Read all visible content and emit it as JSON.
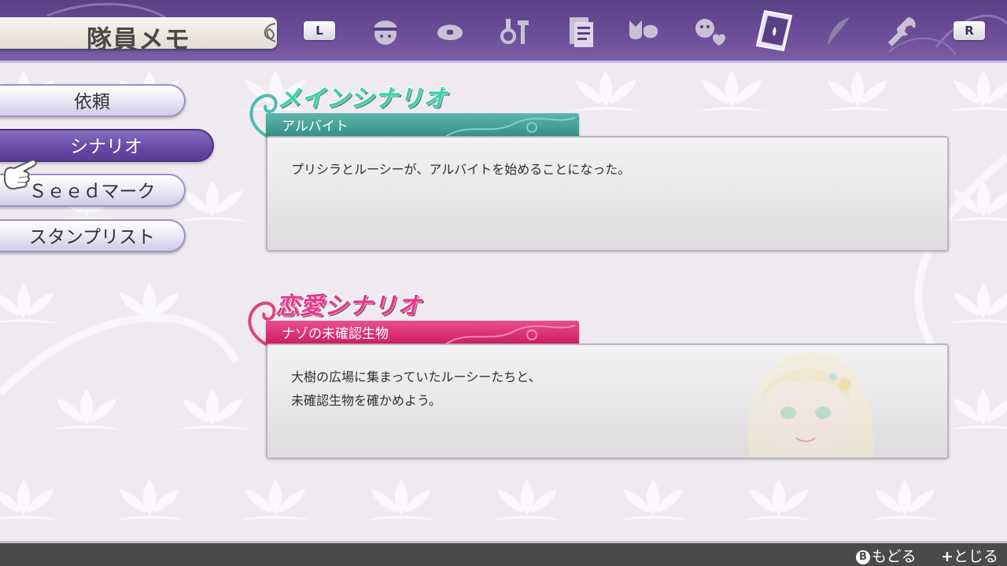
{
  "header": {
    "title": "隊員メモ",
    "left_button": "L",
    "right_button": "R",
    "tabs": [
      {
        "icon": "character-icon"
      },
      {
        "icon": "pouch-icon"
      },
      {
        "icon": "tools-icon"
      },
      {
        "icon": "document-icon"
      },
      {
        "icon": "monsters-icon"
      },
      {
        "icon": "affection-icon"
      },
      {
        "icon": "memo-card-icon",
        "active": true
      },
      {
        "icon": "quill-icon"
      },
      {
        "icon": "wrench-icon"
      }
    ]
  },
  "menu": {
    "items": [
      {
        "label": "依頼"
      },
      {
        "label": "シナリオ",
        "active": true
      },
      {
        "label": "Ｓｅｅｄマーク"
      },
      {
        "label": "スタンプリスト"
      }
    ]
  },
  "main_scenario": {
    "heading": "メインシナリオ",
    "name": "アルバイト",
    "lines": [
      "プリシラとルーシーが、アルバイトを始めることになった。"
    ]
  },
  "love_scenario": {
    "heading": "恋愛シナリオ",
    "name": "ナゾの未確認生物",
    "lines": [
      "大樹の広場に集まっていたルーシーたちと、",
      "未確認生物を確かめよう。"
    ]
  },
  "footer": {
    "back_key": "B",
    "back_label": "もどる",
    "close_key": "+",
    "close_label": "とじる"
  },
  "colors": {
    "header": "#6d4f99",
    "main_accent": "#3dd2ad",
    "love_accent": "#e8358a"
  }
}
